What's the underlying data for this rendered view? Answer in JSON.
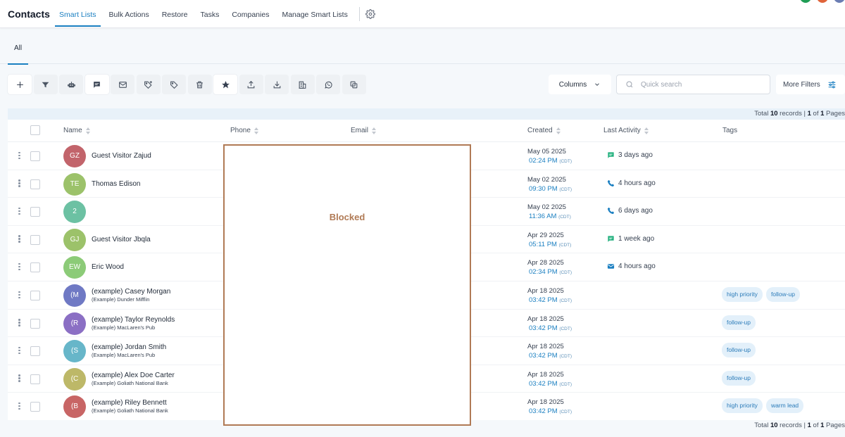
{
  "header": {
    "app_title": "Contacts",
    "tabs": [
      {
        "label": "Smart Lists",
        "active": true
      },
      {
        "label": "Bulk Actions",
        "active": false
      },
      {
        "label": "Restore",
        "active": false
      },
      {
        "label": "Tasks",
        "active": false
      },
      {
        "label": "Companies",
        "active": false
      },
      {
        "label": "Manage Smart Lists",
        "active": false
      }
    ],
    "settings_icon": "gear-icon",
    "avatar_colors": [
      "#1f9d55",
      "#e0643a",
      "#6b7db3"
    ]
  },
  "subtabs": [
    {
      "label": "All",
      "active": true
    }
  ],
  "toolbar": {
    "buttons": [
      {
        "icon": "plus-icon"
      },
      {
        "icon": "filter-icon"
      },
      {
        "icon": "robot-icon"
      },
      {
        "icon": "message-icon"
      },
      {
        "icon": "email-icon"
      },
      {
        "icon": "tag-add-icon"
      },
      {
        "icon": "tag-remove-icon"
      },
      {
        "icon": "trash-icon"
      },
      {
        "icon": "star-icon"
      },
      {
        "icon": "upload-icon"
      },
      {
        "icon": "download-icon"
      },
      {
        "icon": "building-icon"
      },
      {
        "icon": "whatsapp-icon"
      },
      {
        "icon": "duplicate-icon"
      }
    ],
    "columns_label": "Columns",
    "search_placeholder": "Quick search",
    "more_filters_label": "More Filters"
  },
  "pagination": {
    "total_prefix": "Total ",
    "total_count": "10",
    "total_suffix": " records | ",
    "page_current": "1",
    "page_mid": " of ",
    "page_total": "1",
    "page_suffix": " Pages"
  },
  "table": {
    "columns": [
      "Name",
      "Phone",
      "Email",
      "Created",
      "Last Activity",
      "Tags"
    ],
    "rows": [
      {
        "initials": "GZ",
        "avatar_color": "#c2646b",
        "name": "Guest Visitor Zajud",
        "company": "",
        "created_date": "May 05 2025",
        "created_time": "02:24 PM",
        "tz": "(CDT)",
        "activity_icon": "message-icon",
        "activity": "3 days ago",
        "tags": []
      },
      {
        "initials": "TE",
        "avatar_color": "#9cc26a",
        "name": "Thomas Edison",
        "company": "",
        "created_date": "May 02 2025",
        "created_time": "09:30 PM",
        "tz": "(CDT)",
        "activity_icon": "phone-icon",
        "activity": "4 hours ago",
        "tags": []
      },
      {
        "initials": "2",
        "avatar_color": "#6cc1a3",
        "name": "",
        "company": "",
        "created_date": "May 02 2025",
        "created_time": "11:36 AM",
        "tz": "(CDT)",
        "activity_icon": "phone-icon",
        "activity": "6 days ago",
        "tags": []
      },
      {
        "initials": "GJ",
        "avatar_color": "#9cc26a",
        "name": "Guest Visitor Jbqla",
        "company": "",
        "created_date": "Apr 29 2025",
        "created_time": "05:11 PM",
        "tz": "(CDT)",
        "activity_icon": "message-icon",
        "activity": "1 week ago",
        "tags": []
      },
      {
        "initials": "EW",
        "avatar_color": "#8ccb78",
        "name": "Eric Wood",
        "company": "",
        "created_date": "Apr 28 2025",
        "created_time": "02:34 PM",
        "tz": "(CDT)",
        "activity_icon": "email-icon",
        "activity": "4 hours ago",
        "tags": []
      },
      {
        "initials": "(M",
        "avatar_color": "#6f79c4",
        "name": "(example) Casey Morgan",
        "company": "(Example) Dunder Mifflin",
        "created_date": "Apr 18 2025",
        "created_time": "03:42 PM",
        "tz": "(CDT)",
        "activity_icon": "",
        "activity": "",
        "tags": [
          "high priority",
          "follow-up"
        ]
      },
      {
        "initials": "(R",
        "avatar_color": "#8b6fc4",
        "name": "(example) Taylor Reynolds",
        "company": "(Example) MacLaren's Pub",
        "created_date": "Apr 18 2025",
        "created_time": "03:42 PM",
        "tz": "(CDT)",
        "activity_icon": "",
        "activity": "",
        "tags": [
          "follow-up"
        ]
      },
      {
        "initials": "(S",
        "avatar_color": "#67b6c9",
        "name": "(example) Jordan Smith",
        "company": "(Example) MacLaren's Pub",
        "created_date": "Apr 18 2025",
        "created_time": "03:42 PM",
        "tz": "(CDT)",
        "activity_icon": "",
        "activity": "",
        "tags": [
          "follow-up"
        ]
      },
      {
        "initials": "(C",
        "avatar_color": "#bdb868",
        "name": "(example) Alex Doe Carter",
        "company": "(Example) Goliath National Bank",
        "created_date": "Apr 18 2025",
        "created_time": "03:42 PM",
        "tz": "(CDT)",
        "activity_icon": "",
        "activity": "",
        "tags": [
          "follow-up"
        ]
      },
      {
        "initials": "(B",
        "avatar_color": "#c86565",
        "name": "(example) Riley Bennett",
        "company": "(Example) Goliath National Bank",
        "created_date": "Apr 18 2025",
        "created_time": "03:42 PM",
        "tz": "(CDT)",
        "activity_icon": "",
        "activity": "",
        "tags": [
          "high priority",
          "warm lead"
        ]
      }
    ]
  },
  "blocked_overlay": {
    "label": "Blocked",
    "color": "#b07a55"
  }
}
